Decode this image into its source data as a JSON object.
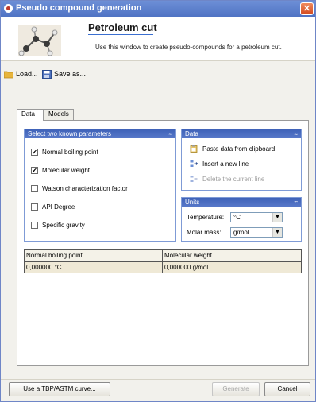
{
  "window": {
    "title": "Pseudo compound generation"
  },
  "header": {
    "title": "Petroleum cut",
    "subtitle": "Use this window to create pseudo-compounds for a petroleum cut."
  },
  "toolbar": {
    "load_label": "Load...",
    "save_label": "Save as..."
  },
  "tabs": [
    {
      "label": "Data",
      "active": true
    },
    {
      "label": "Models",
      "active": false
    }
  ],
  "known_parameters": {
    "title": "Select two known parameters",
    "items": [
      {
        "label": "Normal boiling point",
        "checked": true
      },
      {
        "label": "Molecular weight",
        "checked": true
      },
      {
        "label": "Watson characterization factor",
        "checked": false
      },
      {
        "label": "API Degree",
        "checked": false
      },
      {
        "label": "Specific gravity",
        "checked": false
      }
    ]
  },
  "data_group": {
    "title": "Data",
    "actions": [
      {
        "label": "Paste data from clipboard",
        "enabled": true
      },
      {
        "label": "Insert a new line",
        "enabled": true
      },
      {
        "label": "Delete the current line",
        "enabled": false
      }
    ]
  },
  "units_group": {
    "title": "Units",
    "rows": [
      {
        "label": "Temperature:",
        "value": "°C"
      },
      {
        "label": "Molar mass:",
        "value": "g/mol"
      }
    ]
  },
  "table": {
    "columns": [
      "Normal boiling point",
      "Molecular weight"
    ],
    "rows": [
      [
        "0,000000 °C",
        "0,000000 g/mol"
      ]
    ]
  },
  "footer": {
    "tbp_label": "Use a TBP/ASTM curve...",
    "generate_label": "Generate",
    "cancel_label": "Cancel"
  }
}
